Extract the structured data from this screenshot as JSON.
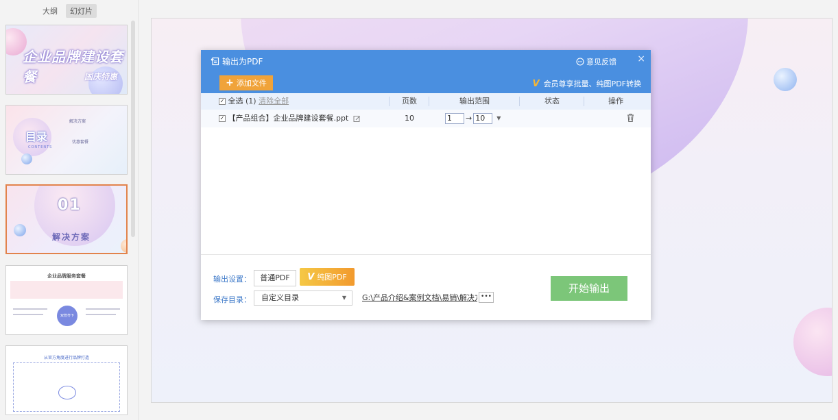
{
  "left_panel": {
    "tabs": [
      "大纲",
      "幻灯片"
    ],
    "slides": [
      {
        "title": "企业品牌建设套餐",
        "subtitle": "国庆特惠"
      },
      {
        "title": "目录",
        "contents_label": "CONTENTS",
        "items": [
          "解决方案",
          "优惠套餐"
        ]
      },
      {
        "number": "01",
        "caption": "解决方案"
      },
      {
        "heading": "企业品牌服务套餐",
        "circle_text": "双管齐下"
      },
      {
        "heading": "从官方角度进行品牌打造"
      }
    ]
  },
  "dialog": {
    "title": "输出为PDF",
    "feedback": "意见反馈",
    "close": "×",
    "add_file": "添加文件",
    "member_note": "会员尊享批量、纯图PDF转换",
    "table": {
      "select_all": "全选 (1)",
      "clear_all": "清除全部",
      "col_pages": "页数",
      "col_range": "输出范围",
      "col_status": "状态",
      "col_action": "操作",
      "rows": [
        {
          "name": "【产品组合】企业品牌建设套餐.ppt",
          "pages": "10",
          "range_from": "1",
          "range_to": "10",
          "status": ""
        }
      ]
    },
    "output_settings_label": "输出设置：",
    "normal_pdf": "普通PDF",
    "pure_pdf": "纯图PDF",
    "save_dir_label": "保存目录：",
    "save_dir_option": "自定义目录",
    "save_path": "G:\\产品介绍&案例文档\\易销\\解决方",
    "more": "•••",
    "start_button": "开始输出"
  },
  "colors": {
    "dialog_header": "#4a8fe0",
    "add_button": "#f0a33a",
    "start_button": "#7cc679",
    "selected_slide_border": "#e2834c"
  }
}
